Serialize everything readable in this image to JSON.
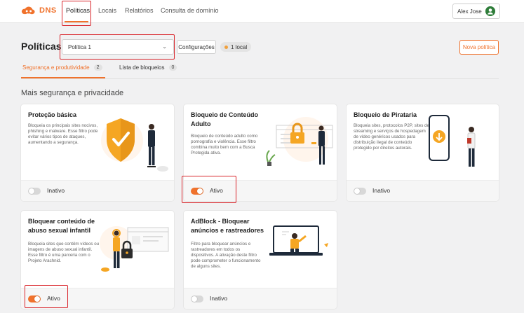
{
  "brand": {
    "name": "DNS",
    "accent_color": "#f0722c",
    "highlight_color": "#d9252b"
  },
  "nav": {
    "items": [
      {
        "label": "Políticas",
        "active": true
      },
      {
        "label": "Locais",
        "active": false
      },
      {
        "label": "Relatórios",
        "active": false
      },
      {
        "label": "Consulta de domínio",
        "active": false
      }
    ]
  },
  "user": {
    "name": "Alex Jose",
    "avatar_icon": "user-avatar-icon"
  },
  "header": {
    "title": "Políticas",
    "policy_select_value": "Política 1",
    "config_label": "Configurações",
    "local_badge": "1 local",
    "new_policy_label": "Nova política"
  },
  "tabs": [
    {
      "label": "Segurança e produtividade",
      "count": "2",
      "active": true
    },
    {
      "label": "Lista de bloqueios",
      "count": "0",
      "active": false
    }
  ],
  "section_title": "Mais segurança e privacidade",
  "cards": [
    {
      "title": "Proteção básica",
      "description": "Bloqueia os principais sites nocivos, phishing e malware. Esse filtro pode evitar vários tipos de ataques, aumentando a segurança.",
      "toggle_on": false,
      "status": "Inativo",
      "illustration": "shield-check-icon"
    },
    {
      "title": "Bloqueio de Conteúdo Adulto",
      "description": "Bloqueio de conteúdo adulto como pornografia e violência. Esse filtro combina muito bem com a Busca Protegida ativa.",
      "toggle_on": true,
      "status": "Ativo",
      "illustration": "padlock-icon"
    },
    {
      "title": "Bloqueio de Pirataria",
      "description": "Bloqueia sites, protocolos P2P, sites de streaming e serviços de hospedagem de vídeo genéricos usados para distribuição ilegal de conteúdo protegido por direitos autorais.",
      "toggle_on": false,
      "status": "Inativo",
      "illustration": "smartphone-icon"
    },
    {
      "title": "Bloquear conteúdo de abuso sexual infantil",
      "description": "Bloqueia sites que contêm vídeos ou imagens de abuso sexual infantil. Esse filtro é uma parceria com o Projeto Arachnid.",
      "toggle_on": true,
      "status": "Ativo",
      "illustration": "padlock-person-icon"
    },
    {
      "title": "AdBlock - Bloquear anúncios e rastreadores",
      "description": "Filtro para bloquear anúncios e rastreadores em todos os dispositivos. A ativação deste filtro pode comprometer o funcionamento de alguns sites.",
      "toggle_on": false,
      "status": "Inativo",
      "illustration": "laptop-icon"
    }
  ]
}
